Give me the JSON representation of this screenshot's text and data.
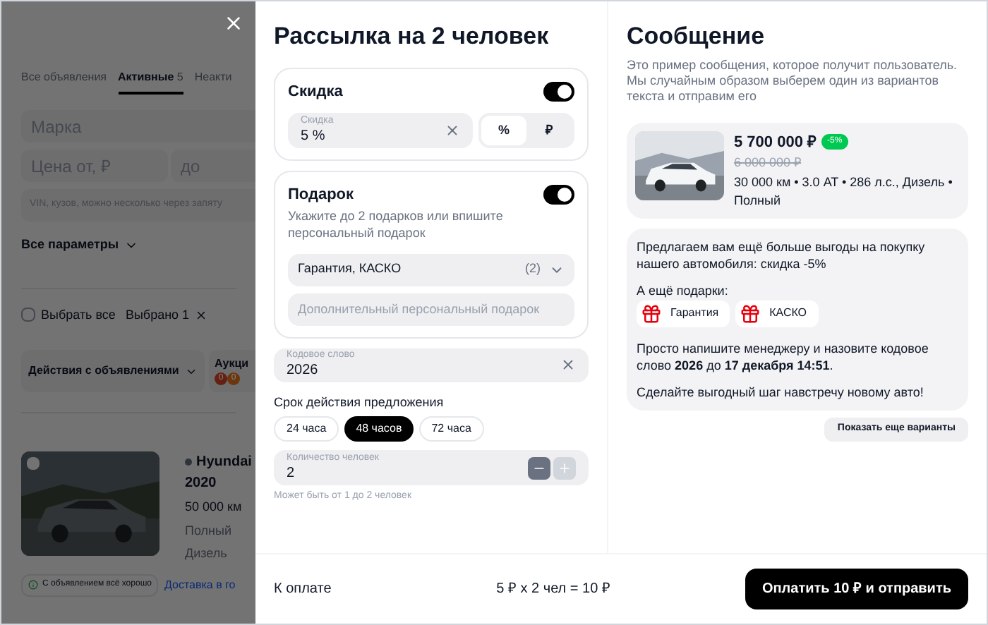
{
  "background_page": {
    "tabs": [
      {
        "label": "Все объявления",
        "selected": false
      },
      {
        "label": "Активные",
        "count": "5",
        "selected": true
      },
      {
        "label": "Неакти",
        "selected": false
      }
    ],
    "filters": {
      "brand_placeholder": "Марка",
      "price_from_placeholder": "Цена от, ₽",
      "price_to_placeholder": "до",
      "vin_placeholder": "VIN, кузов, можно несколько через запяту"
    },
    "all_params": "Все параметры",
    "select_all": {
      "label": "Выбрать все",
      "checked": false
    },
    "selected_count": "Выбрано 1",
    "actions_button": "Действия с объявлениями",
    "auction": {
      "label": "Аукци",
      "badges": [
        {
          "text": "0",
          "color": "#651f13"
        },
        {
          "text": "0",
          "color": "#6c370f"
        }
      ]
    },
    "listing": {
      "checked": false,
      "title": "Hyundai",
      "year": "2020",
      "mileage": "50 000 км",
      "drive": "Полный",
      "fuel": "Дизель",
      "status": "С объявлением всё хорошо",
      "delivery": "Доставка в го"
    }
  },
  "modal": {
    "title": "Рассылка на 2 человек",
    "discount": {
      "label": "Скидка",
      "on": true,
      "field_label": "Скидка",
      "value": "5 %",
      "units": [
        {
          "label": "%",
          "selected": true
        },
        {
          "label": "₽",
          "selected": false
        }
      ]
    },
    "gift": {
      "label": "Подарок",
      "on": true,
      "hint": "Укажите до 2 подарков или впишите персональный подарок",
      "select_value": "Гарантия, КАСКО",
      "select_count": "(2)",
      "custom_placeholder": "Дополнительный персональный подарок"
    },
    "code_word": {
      "label": "Кодовое слово",
      "value": "2026"
    },
    "validity": {
      "label": "Срок действия предложения",
      "options": [
        {
          "label": "24 часа",
          "selected": false
        },
        {
          "label": "48 часов",
          "selected": true
        },
        {
          "label": "72 часа",
          "selected": false
        }
      ]
    },
    "people": {
      "label": "Количество человек",
      "value": "2",
      "minus_disabled": false,
      "plus_disabled": true,
      "hint": "Может быть от 1 до 2 человек"
    },
    "message": {
      "title": "Сообщение",
      "description": "Это пример сообщения, которое получит пользователь. Мы случайным образом выберем один из вариантов текста и отправим его",
      "car": {
        "price": "5 700 000 ₽",
        "discount_badge": "-5%",
        "old_price": "6 000 000 ₽",
        "specs": "30 000 км • 3.0 AT • 286 л.с., Дизель • Полный"
      },
      "intro": "Предлагаем вам ещё больше выгоды на покупку нашего автомобиля: скидка -5%",
      "gifts_label": "А ещё подарки:",
      "gifts": [
        "Гарантия",
        "КАСКО"
      ],
      "instruction": "Просто напишите менеджеру и назовите кодовое слово **2026** до **17 декабря 14:51**.",
      "closing": "Сделайте выгодный шаг навстречу новому авто!",
      "more_button": "Показать еще варианты"
    },
    "footer": {
      "total_label": "К оплате",
      "total": "5 ₽ x 2 чел = 10 ₽",
      "pay_button": "Оплатить 10 ₽ и отправить"
    }
  }
}
